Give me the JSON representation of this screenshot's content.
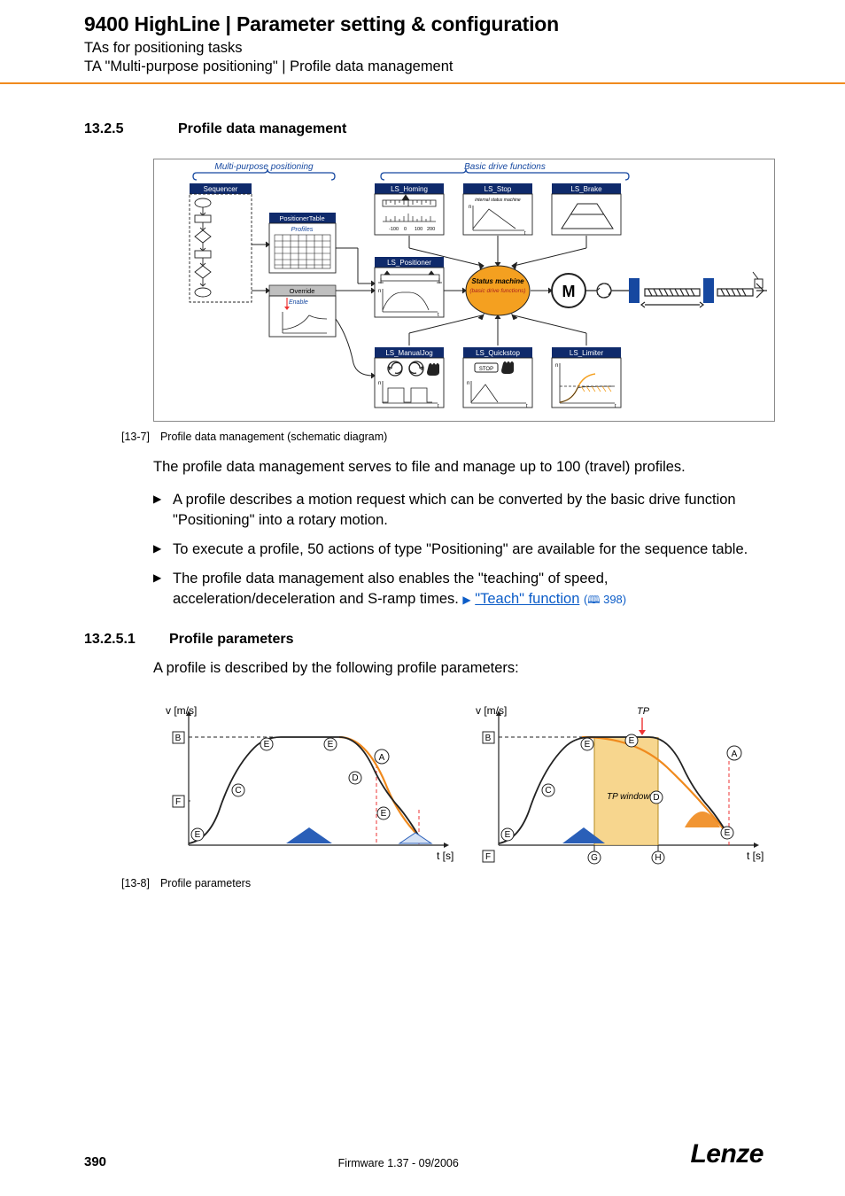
{
  "header": {
    "title": "9400 HighLine | Parameter setting & configuration",
    "sub1": "TAs for positioning tasks",
    "sub2": "TA \"Multi-purpose positioning\" | Profile data management"
  },
  "section": {
    "num": "13.2.5",
    "title": "Profile data management"
  },
  "fig1": {
    "id": "[13-7]",
    "caption": "Profile data management (schematic diagram)",
    "labels": {
      "mpp": "Multi-purpose positioning",
      "bdf": "Basic drive functions",
      "sequencer": "Sequencer",
      "positionerTable": "PositionerTable",
      "profiles": "Profiles",
      "override": "Override",
      "enable": "Enable",
      "ls_homing": "LS_Homing",
      "ls_stop": "LS_Stop",
      "ls_brake": "LS_Brake",
      "ls_positioner": "LS_Positioner",
      "status_machine": "Status machine",
      "basic_drive_fn": "(basic drive functions)",
      "internal_sm": "internal status machine",
      "ls_manualjog": "LS_ManualJog",
      "ls_quickstop": "LS_Quickstop",
      "ls_limiter": "LS_Limiter",
      "stop": "STOP",
      "axis_minus100": "-100",
      "axis_0": "0",
      "axis_100": "100",
      "axis_200": "200",
      "m": "M",
      "n": "n",
      "t": "t"
    }
  },
  "paragraph1": "The profile data management serves to file and manage up to 100 (travel) profiles.",
  "bullets": {
    "b1": "A profile describes a motion request which can be converted by the basic drive function \"Positioning\" into a rotary motion.",
    "b2": "To execute a profile, 50 actions of type \"Positioning\" are available for the sequence table.",
    "b3a": "The profile data management also enables the \"teaching\" of speed, acceleration/deceleration and S-ramp times.  ",
    "b3_link": "\"Teach\" function",
    "b3_page": "398"
  },
  "subsection": {
    "num": "13.2.5.1",
    "title": "Profile parameters"
  },
  "paragraph2": "A profile is described by the following profile parameters:",
  "fig2": {
    "id": "[13-8]",
    "caption": "Profile parameters",
    "labels": {
      "v": "v [m/s]",
      "t": "t [s]",
      "TP": "TP",
      "TPwindow": "TP window",
      "A": "A",
      "B": "B",
      "C": "C",
      "D": "D",
      "E": "E",
      "F": "F",
      "G": "G",
      "H": "H"
    }
  },
  "footer": {
    "page": "390",
    "fw": "Firmware 1.37 - 09/2006",
    "brand": "Lenze"
  }
}
